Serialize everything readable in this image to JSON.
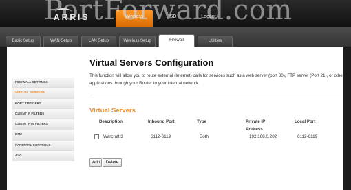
{
  "watermark": "PortForward.com",
  "brand": {
    "logo_text": "ARRIS"
  },
  "top_nav": {
    "items": [
      "Wireless",
      "HSD",
      "Logout"
    ],
    "active": "Wireless"
  },
  "tabs": [
    "Basic Setup",
    "WAN Setup",
    "LAN Setup",
    "Wireless Setup",
    "Firewall",
    "Utilities"
  ],
  "active_tab": "Firewall",
  "sidebar": {
    "items": [
      "FIREWALL SETTINGS",
      "VIRTUAL SERVERS",
      "PORT TRIGGERS",
      "CLIENT IP FILTERS",
      "CLIENT IPV6 FILTERS",
      "DMZ",
      "PARENTAL CONTROLS",
      "ALG"
    ],
    "active": "VIRTUAL SERVERS"
  },
  "page": {
    "title": "Virtual Servers Configuration",
    "description": "This function will allow you to route external (Internet) calls for services such as a web server (port 80), FTP server (Port 21), or other applications through your Router to your internal network."
  },
  "table": {
    "section_title": "Virtual Servers",
    "headers": {
      "description": "Description",
      "inbound": "Inbound Port",
      "type": "Type",
      "private_ip": "Private IP Address",
      "local": "Local Port"
    },
    "rows": [
      {
        "description": "Warcraft 3",
        "inbound": "6112-6119",
        "type": "Both",
        "private_ip": "192.168.0.202",
        "local": "6112-6119"
      }
    ]
  },
  "buttons": {
    "add": "Add",
    "delete": "Delete"
  },
  "colors": {
    "accent": "#f08a24",
    "nav_active": "#e87d0c"
  }
}
